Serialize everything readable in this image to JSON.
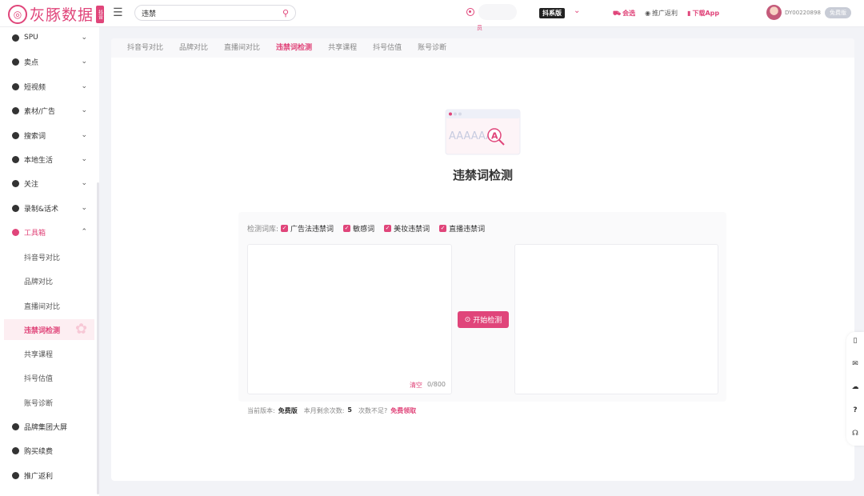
{
  "header": {
    "logo_text": "灰豚数据",
    "logo_badge": "抖音",
    "search_value": "违禁",
    "center_label": "员",
    "platform": "抖系版",
    "links": [
      {
        "label": "会选",
        "icon": "cart-icon"
      },
      {
        "label": "推广返利",
        "icon": "coin-icon"
      },
      {
        "label": "下载App",
        "icon": "phone-icon"
      }
    ],
    "user_id": "DY00220898",
    "badge": "免费版"
  },
  "sidebar": {
    "items": [
      {
        "label": "SPU"
      },
      {
        "label": "卖点"
      },
      {
        "label": "短视频"
      },
      {
        "label": "素材/广告"
      },
      {
        "label": "搜索词"
      },
      {
        "label": "本地生活"
      },
      {
        "label": "关注"
      },
      {
        "label": "录制&话术"
      },
      {
        "label": "工具箱"
      }
    ],
    "sub_items": [
      {
        "label": "抖音号对比"
      },
      {
        "label": "品牌对比"
      },
      {
        "label": "直播间对比"
      },
      {
        "label": "违禁词检测"
      },
      {
        "label": "共享课程"
      },
      {
        "label": "抖号估值"
      },
      {
        "label": "账号诊断"
      }
    ],
    "bottom_items": [
      {
        "label": "品牌集团大屏"
      },
      {
        "label": "购买续费"
      },
      {
        "label": "推广返利"
      }
    ]
  },
  "tabs": [
    {
      "label": "抖音号对比"
    },
    {
      "label": "品牌对比"
    },
    {
      "label": "直播间对比"
    },
    {
      "label": "违禁词检测"
    },
    {
      "label": "共享课程"
    },
    {
      "label": "抖号估值"
    },
    {
      "label": "账号诊断"
    }
  ],
  "main": {
    "illus_text": "AAAAAAA",
    "illus_letter": "A",
    "title": "违禁词检测",
    "lib_label": "检测词库:",
    "libs": [
      {
        "label": "广告法违禁词",
        "checked": true
      },
      {
        "label": "敏感词",
        "checked": true
      },
      {
        "label": "美妆违禁词",
        "checked": true
      },
      {
        "label": "直播违禁词",
        "checked": true
      }
    ],
    "input_value": "",
    "clear_label": "清空",
    "counter": "0/800",
    "start_button": "开始检测"
  },
  "footer": {
    "version_label": "当前版本:",
    "version_value": "免费版",
    "remain_label": "本月剩余次数:",
    "remain_value": "5",
    "not_enough": "次数不足?",
    "claim": "免费领取"
  },
  "float_bar": {
    "icons": [
      "phone-icon",
      "mail-icon",
      "wechat-icon",
      "help-icon",
      "headset-icon"
    ],
    "help_glyph": "?"
  },
  "colors": {
    "accent": "#e0457a",
    "accent_light": "#fdeef2"
  }
}
